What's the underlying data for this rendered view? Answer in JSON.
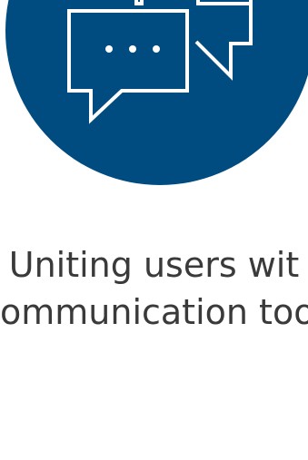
{
  "colors": {
    "circle_fill": "#004c81",
    "icon_stroke": "#ffffff",
    "text": "#3a3a3a",
    "background": "#ffffff"
  },
  "hero": {
    "icon": "chat-bubbles-icon"
  },
  "caption": {
    "line1": "Uniting users wit",
    "line2": "ommunication too"
  }
}
